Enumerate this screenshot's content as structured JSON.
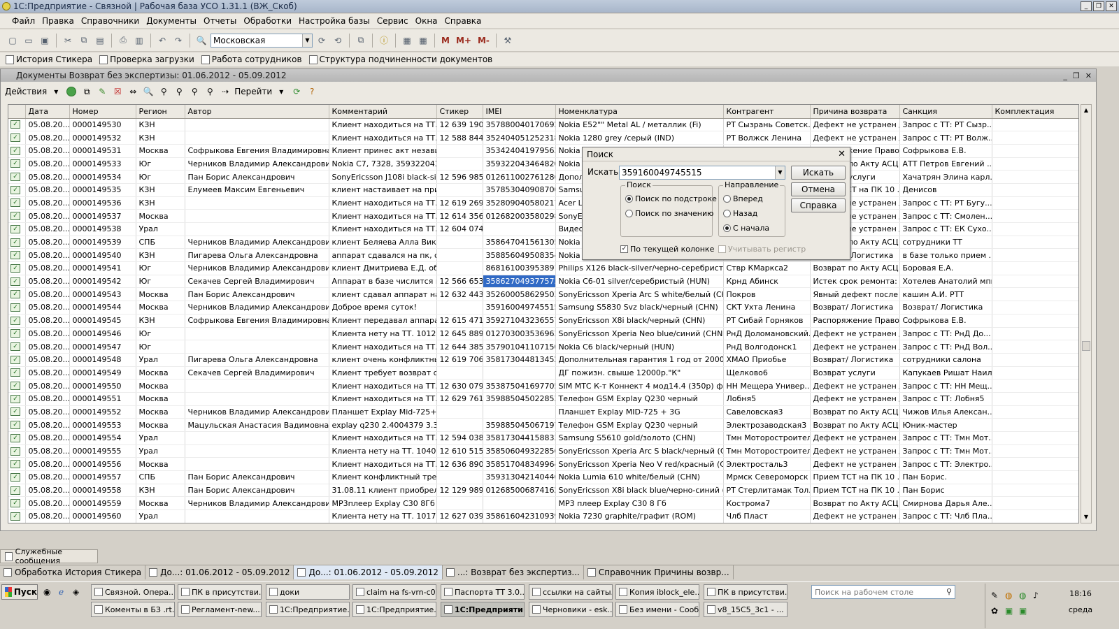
{
  "window": {
    "title": "1С:Предприятие - Связной | Рабочая база УСО 1.31.1 (ВЖ_Скоб)"
  },
  "menu": [
    "Файл",
    "Правка",
    "Справочники",
    "Документы",
    "Отчеты",
    "Обработки",
    "Настройка базы",
    "Сервис",
    "Окна",
    "Справка"
  ],
  "toolbar": {
    "combo_value": "Московская",
    "m_label": "M",
    "mplus_label": "M+",
    "mminus_label": "M-"
  },
  "shortcuts": [
    "История Стикера",
    "Проверка загрузки",
    "Работа сотрудников",
    "Структура подчиненности документов"
  ],
  "doc": {
    "title": "Документы Возврат без экспертизы: 01.06.2012 - 05.09.2012",
    "actions_label": "Действия",
    "goto_label": "Перейти",
    "columns": [
      "Дата",
      "Номер",
      "Регион",
      "Автор",
      "Комментарий",
      "Стикер",
      "IMEI",
      "Номенклатура",
      "Контрагент",
      "Причина возврата",
      "Санкция",
      "Комплектация"
    ],
    "rows": [
      [
        "05.08.20...",
        "0000149530",
        "КЗН",
        "",
        "Клиент находиться на ТТ. ...",
        "12 639 190",
        "357880040170692",
        "Nokia E52\"\" Metal AL / металлик  (Fi)",
        "РТ Сызрань Советск...",
        "Дефект не устранен /...",
        "Запрос с ТТ: РТ Сызр...",
        ""
      ],
      [
        "05.08.20...",
        "0000149532",
        "КЗН",
        "",
        "Клиент находиться на ТТ. ...",
        "12 588 844",
        "352404051252318",
        "Nokia 1280 grey /серый (IND)",
        "РТ Волжск Ленина",
        "Дефект не устранен /...",
        "Запрос с ТТ: РТ Волж...",
        ""
      ],
      [
        "05.08.20...",
        "0000149531",
        "Москва",
        "Софрыкова Евгения Владимировна",
        "Клиент принес акт незави...",
        "",
        "353424041979563",
        "Nokia",
        "",
        "Распоряжение Право...",
        "Софрыкова Е.В.",
        ""
      ],
      [
        "05.08.20...",
        "0000149533",
        "Юг",
        "Черников Владимир Александрови",
        "Nokia C7, 7328, 359322043...",
        "",
        "359322043464820",
        "Nokia",
        "",
        "Возврат по Акту АСЦ",
        "АТТ Петров Евгений ...",
        ""
      ],
      [
        "05.08.20...",
        "0000149534",
        "Юг",
        "Пан Борис Александрович",
        "SonyEricsson J108i black-silv...",
        "12 596 985",
        "012611002761286",
        "Допол",
        "",
        "Возврат услуги",
        "Хачатрян Элина карл...",
        ""
      ],
      [
        "05.08.20...",
        "0000149535",
        "КЗН",
        "Елумеев Максим Евгеньевич",
        "клиент настаивает на приня...",
        "",
        "357853040908700",
        "Samsu",
        "",
        "Прием ТСТ на ПК 10 ...",
        "Денисов",
        ""
      ],
      [
        "05.08.20...",
        "0000149536",
        "КЗН",
        "",
        "Клиент находиться на ТТ. ...",
        "12 619 269",
        "352809040580217",
        "Acer L",
        "",
        "Дефект не устранен /...",
        "Запрос с ТТ: РТ Бугу...",
        ""
      ],
      [
        "05.08.20...",
        "0000149537",
        "Москва",
        "",
        "Клиент находиться на ТТ. ...",
        "12 614 356",
        "012682003580298",
        "SonyE",
        "",
        "Дефект не устранен /...",
        "Запрос с ТТ: Смолен...",
        ""
      ],
      [
        "05.08.20...",
        "0000149538",
        "Урал",
        "",
        "Клиент находиться на ТТ. ...",
        "12 604 074",
        "",
        "Видео",
        "",
        "Дефект не устранен /...",
        "Запрос с ТТ: ЕК Сухо...",
        ""
      ],
      [
        "05.08.20...",
        "0000149539",
        "СПБ",
        "Черников Владимир Александрови",
        "клиент Беляева Алла Викт...",
        "",
        "358647041561305",
        "Nokia",
        "",
        "Возврат по Акту АСЦ",
        "сотрудники ТТ",
        ""
      ],
      [
        "05.08.20...",
        "0000149540",
        "КЗН",
        "Пигарева Ольга Александровна",
        "аппарат сдавался на пк, с...",
        "",
        "358856049508354",
        "Nokia",
        "",
        "Возврат/ Логистика",
        "в базе только прием ...",
        ""
      ],
      [
        "05.08.20...",
        "0000149541",
        "Юг",
        "Черников Владимир Александрови",
        "клиент Дмитриева Е.Д. об...",
        "",
        "868161003953891",
        "Philips X126 black-silver/черно-серебристый (...",
        "Ствр КМаркса2",
        "Возврат по Акту АСЦ",
        "Боровая Е.А.",
        ""
      ],
      [
        "05.08.20...",
        "0000149542",
        "Юг",
        "Секачев Сергей Владимирович",
        "Аппарат в базе числится п...",
        "12 566 653",
        "358627049377573",
        "Nokia C6-01 silver/серебристый (HUN)",
        "Крнд Абинск",
        "Истек срок ремонта: ...",
        "Хотелев Анатолий мпп",
        ""
      ],
      [
        "05.08.20...",
        "0000149543",
        "Москва",
        "Пан Борис Александрович",
        "клиент сдавал аппарат на ...",
        "12 632 443",
        "352600058629503",
        "SonyEricsson Xperia Arc S white/белый (CHN)",
        "Покров",
        "Явный дефект после ...",
        "кашин А.И. РТТ",
        ""
      ],
      [
        "05.08.20...",
        "0000149544",
        "Москва",
        "Черников Владимир Александрови",
        "Доброе время суток!",
        "",
        "359160049745515",
        "Samsung S5830 Svz black/черный (CHN)",
        "СКТ Ухта Ленина",
        "Возврат/ Логистика",
        "Возврат/ Логистика",
        ""
      ],
      [
        "05.08.20...",
        "0000149545",
        "КЗН",
        "Софрыкова Евгения Владимировна",
        "Клиент передавал аппарат...",
        "12 615 471",
        "359271043236557",
        "SonyEricsson X8i black/черный (CHN)",
        "РТ Сибай Горняков",
        "Распоряжение Право...",
        "Софрыкова Е.В.",
        ""
      ],
      [
        "05.08.20...",
        "0000149546",
        "Юг",
        "",
        "Клиента нету на ТТ. 10126,...",
        "12 645 889",
        "012703003536963",
        "SonyEricsson Xperia Neo blue/синий (CHN)",
        "РнД Доломановский...",
        "Дефект не устранен /...",
        "Запрос с ТТ: РнД До...",
        ""
      ],
      [
        "05.08.20...",
        "0000149547",
        "Юг",
        "",
        "Клиент находиться на ТТ. ...",
        "12 644 385",
        "357901041107150",
        "Nokia C6 black/черный (HUN)",
        "РнД Волгодонск1",
        "Дефект не устранен /...",
        "Запрос с ТТ: РнД Вол...",
        ""
      ],
      [
        "05.08.20...",
        "0000149548",
        "Урал",
        "Пигарева Ольга Александровна",
        "клиент очень конфликтный...",
        "12 619 706",
        "358173044813452",
        "Дополнительная гарантия 1 год от 2000 до ...",
        "ХМАО Приобье",
        "Возврат/ Логистика",
        "сотрудники салона",
        ""
      ],
      [
        "05.08.20...",
        "0000149549",
        "Москва",
        "Секачев Сергей Владимирович",
        "Клиент требует возврат сс...",
        "",
        "",
        "ДГ пожизн. свыше 12000р.\"К\"",
        "Щелково6",
        "Возврат услуги",
        "Капукаев Ришат Наил...",
        ""
      ],
      [
        "05.08.20...",
        "0000149550",
        "Москва",
        "",
        "Клиент находиться на ТТ. ...",
        "12 630 079",
        "353875041697705",
        "SIM МТС К-т Коннект 4 мод14.4 (350р) ф НН",
        "НН Мещера Универ...",
        "Дефект не устранен /...",
        "Запрос с ТТ: НН Мещ...",
        ""
      ],
      [
        "05.08.20...",
        "0000149551",
        "Москва",
        "",
        "Клиент находиться на ТТ. ...",
        "12 629 761",
        "359885045022853",
        "Телефон GSM Explay Q230 черный",
        "Лобня5",
        "Дефект не устранен /...",
        "Запрос с ТТ: Лобня5",
        ""
      ],
      [
        "05.08.20...",
        "0000149552",
        "Москва",
        "Черников Владимир Александрови",
        "Планшет Explay Mid-725+3...",
        "",
        "",
        "Планшет Explay MID-725 + 3G",
        "Савеловская3",
        "Возврат по Акту АСЦ",
        "Чижов Илья Алексан...",
        ""
      ],
      [
        "05.08.20...",
        "0000149553",
        "Москва",
        "Мацульская Анастасия Вадимовна",
        "explay q230 2.4004379 3.31...",
        "",
        "359885045067197",
        "Телефон GSM Explay Q230 черный",
        "Электрозаводская3",
        "Возврат по Акту АСЦ",
        "Юник-мастер",
        ""
      ],
      [
        "05.08.20...",
        "0000149554",
        "Урал",
        "",
        "Клиент находиться на ТТ. ...",
        "12 594 038",
        "358173044158833",
        "Samsung S5610 gold/золото (CHN)",
        "Тмн Моторостроител...",
        "Дефект не устранен /...",
        "Запрос с ТТ: Тмн Мот...",
        ""
      ],
      [
        "05.08.20...",
        "0000149555",
        "Урал",
        "",
        "Клиента нету на ТТ. 10400",
        "12 610 515",
        "358506049322856",
        "SonyEricsson Xperia Arc S black/черный (CHN)",
        "Тмн Моторостроител...",
        "Дефект не устранен /...",
        "Запрос с ТТ: Тмн Мот...",
        ""
      ],
      [
        "05.08.20...",
        "0000149556",
        "Москва",
        "",
        "Клиент находиться на ТТ. ...",
        "12 636 890",
        "358517048349964",
        "SonyEricsson Xperia Neo V red/красный (CHN)",
        "Электросталь3",
        "Дефект не устранен /...",
        "Запрос с ТТ: Электро...",
        ""
      ],
      [
        "05.08.20...",
        "0000149557",
        "СПБ",
        "Пан Борис Александрович",
        "Клиент конфликтный требу...",
        "",
        "359313042140446",
        "Nokia Lumia 610 white/белый (CHN)",
        "Мрмск Североморск 2",
        "Прием ТСТ на ПК 10 ...",
        "Пан Борис.",
        ""
      ],
      [
        "05.08.20...",
        "0000149558",
        "КЗН",
        "Пан Борис Александрович",
        "31.08.11 клиент приобрел ...",
        "12 129 989",
        "012685006874162",
        "SonyEricsson X8i black blue/черно-синий (CHN)",
        "РТ Стерлитамак Тол...",
        "Прием ТСТ на ПК 10 ...",
        "Пан Борис",
        ""
      ],
      [
        "05.08.20...",
        "0000149559",
        "Москва",
        "Черников Владимир Александрови",
        "МР3плеер Explay C30 8Гб а...",
        "",
        "",
        "МР3 плеер Explay C30 8 Гб",
        "Кострома7",
        "Возврат по Акту АСЦ",
        "Смирнова Дарья Але...",
        ""
      ],
      [
        "05.08.20...",
        "0000149560",
        "Урал",
        "",
        "Клиента нету на ТТ. 10175,...",
        "12 627 039",
        "358616042310939",
        "Nokia 7230 graphite/графит (ROM)",
        "Члб Пласт",
        "Дефект не устранен /...",
        "Запрос с ТТ: Члб Пла...",
        ""
      ]
    ]
  },
  "search_dialog": {
    "title": "Поиск",
    "find_label": "Искать:",
    "find_value": "359160049745515",
    "search_group": "Поиск",
    "by_substring": "Поиск по подстроке",
    "by_value": "Поиск по значению",
    "direction_group": "Направление",
    "forward": "Вперед",
    "backward": "Назад",
    "from_start": "С начала",
    "current_column": "По текущей колонке",
    "match_case": "Учитывать регистр",
    "find_button": "Искать",
    "cancel_button": "Отмена",
    "help_button": "Справка"
  },
  "service_messages": "Служебные сообщения",
  "window_tabs": [
    "Обработка История Стикера",
    "До...: 01.06.2012 - 05.09.2012",
    "До...: 01.06.2012 - 05.09.2012",
    "...: Возврат без экспертиз...",
    "Справочник Причины возвр..."
  ],
  "taskbar": {
    "start": "Пуск",
    "row1": [
      "Связной. Опера...",
      "ПК в присутстви...",
      "доки",
      "claim на fs-vrn-c0...",
      "Паспорта ТТ 3.0...",
      "ссылки на сайты...",
      "Копия iblock_ele...",
      "ПК в присутстви..."
    ],
    "row2": [
      "Коменты в БЗ .rt...",
      "Регламент-new....",
      "1С:Предприятие...",
      "1С:Предприятие...",
      "1С:Предприяти...",
      "Черновики - esk...",
      "Без имени - Сооб...",
      "v8_15C5_3c1 - ..."
    ],
    "desktop_search": "Поиск на рабочем столе",
    "time": "18:16",
    "day": "среда"
  },
  "colors": {
    "selection": "#316ac5",
    "titlebar": "#b3c0d3"
  }
}
